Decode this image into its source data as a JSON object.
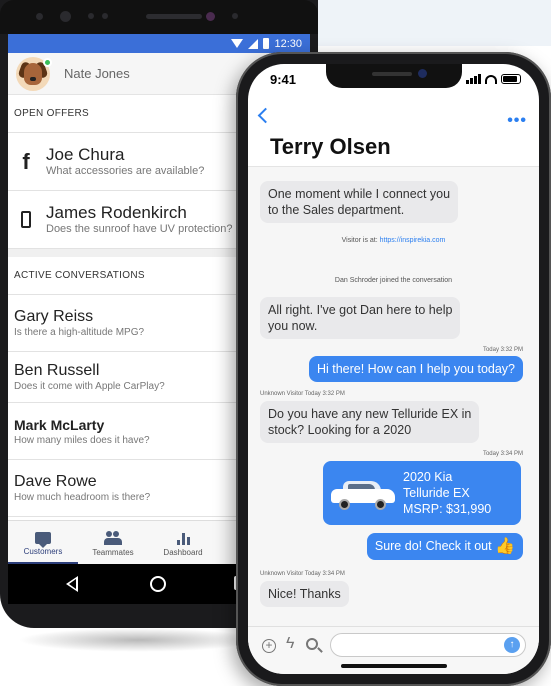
{
  "android": {
    "status_time": "12:30",
    "user_name": "Nate Jones",
    "open_offers_header": "OPEN OFFERS",
    "offers": [
      {
        "icon": "facebook-icon",
        "glyph": "f",
        "name": "Joe Chura",
        "message": "What accessories are available?"
      },
      {
        "icon": "phone-icon",
        "glyph": "",
        "name": "James Rodenkirch",
        "message": "Does the sunroof have UV protection?"
      }
    ],
    "active_header": "ACTIVE CONVERSATIONS",
    "conversations": [
      {
        "name": "Gary Reiss",
        "message": "Is there a high-altitude MPG?"
      },
      {
        "name": "Ben Russell",
        "message": "Does it come with Apple CarPlay?"
      },
      {
        "name": "Mark McLarty",
        "message": "How many miles does it have?"
      },
      {
        "name": "Dave Rowe",
        "message": "How much headroom is there?"
      }
    ],
    "tabs": [
      {
        "icon": "chat-icon",
        "label": "Customers",
        "active": true
      },
      {
        "icon": "teammates-icon",
        "label": "Teammates",
        "active": false
      },
      {
        "icon": "dashboard-icon",
        "label": "Dashboard",
        "active": false
      }
    ],
    "nav_icons": [
      "back-triangle-icon",
      "home-circle-icon",
      "recents-square-icon"
    ]
  },
  "iphone": {
    "status_time": "9:41",
    "contact_name": "Terry Olsen",
    "more_label": "•••",
    "messages": {
      "m1": "One moment while I connect you",
      "m1b": "to the Sales department.",
      "sys_visitor_prefix": "Visitor is at: ",
      "sys_visitor_link": "https://inspirekia.com",
      "sys_joined": "Dan Schroder joined the conversation",
      "m2": "All right. I've got Dan here to help",
      "m2b": "you now.",
      "ts1": "Today 3:32 PM",
      "m3": "Hi there! How can I help you today?",
      "ts2": "Unknown Visitor Today 3:32 PM",
      "m4": "Do you have any new Telluride EX in",
      "m4b": "stock? Looking for a 2020",
      "ts3": "Today 3:34 PM",
      "car_line1": "2020 Kia",
      "car_line2": "Telluride EX",
      "car_line3": "MSRP: $31,990",
      "m5": "Sure do! Check it out",
      "m5_emoji": "👍",
      "ts4": "Unknown Visitor Today 3:34 PM",
      "m6": "Nice! Thanks"
    },
    "input": {
      "value": "",
      "placeholder": "",
      "icons": [
        "plus-icon",
        "bolt-icon",
        "search-icon",
        "send-icon"
      ]
    }
  },
  "colors": {
    "android_status": "#3b6fd8",
    "outgoing_bubble": "#3b86f0",
    "incoming_bubble": "#e9e9eb",
    "accent_blue": "#2b7ff0",
    "online": "#3bbf5a"
  }
}
